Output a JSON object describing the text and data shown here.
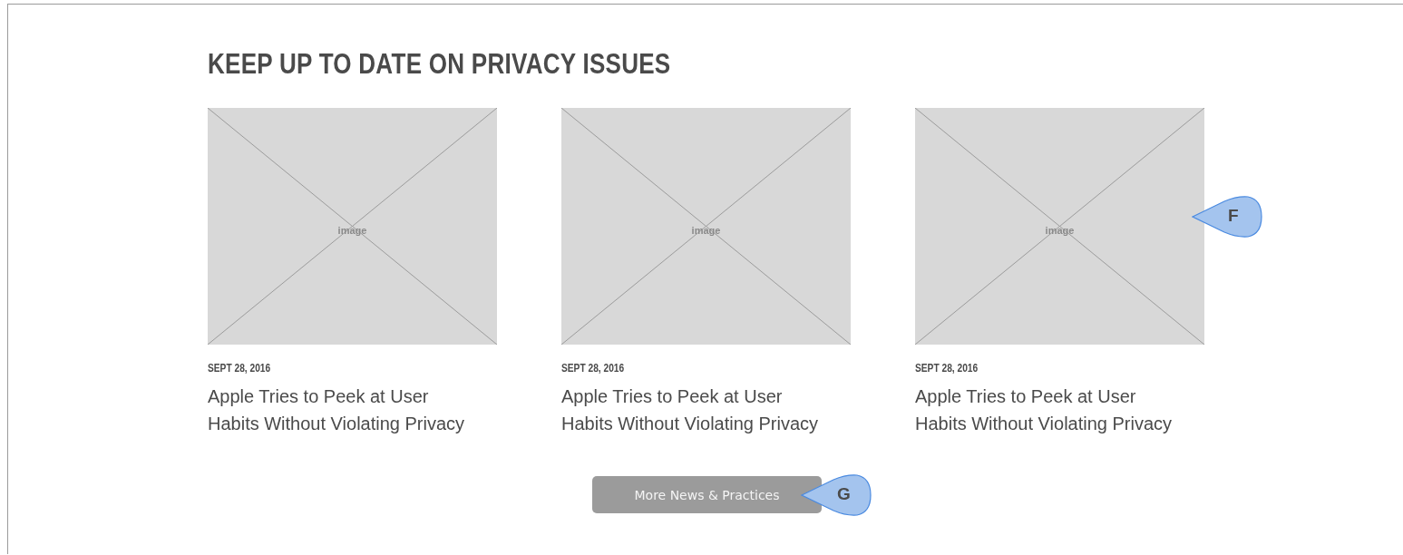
{
  "section": {
    "heading": "KEEP UP TO DATE ON PRIVACY ISSUES"
  },
  "articles": [
    {
      "image_label": "image",
      "date": "SEPT 28, 2016",
      "title": "Apple Tries to Peek at User Habits Without Violating Privacy"
    },
    {
      "image_label": "image",
      "date": "SEPT 28, 2016",
      "title": "Apple Tries to Peek at User Habits Without Violating Privacy"
    },
    {
      "image_label": "image",
      "date": "SEPT 28, 2016",
      "title": "Apple Tries to Peek at User Habits Without Violating Privacy",
      "marker": "F"
    }
  ],
  "button": {
    "label": "More News & Practices",
    "marker": "G"
  }
}
